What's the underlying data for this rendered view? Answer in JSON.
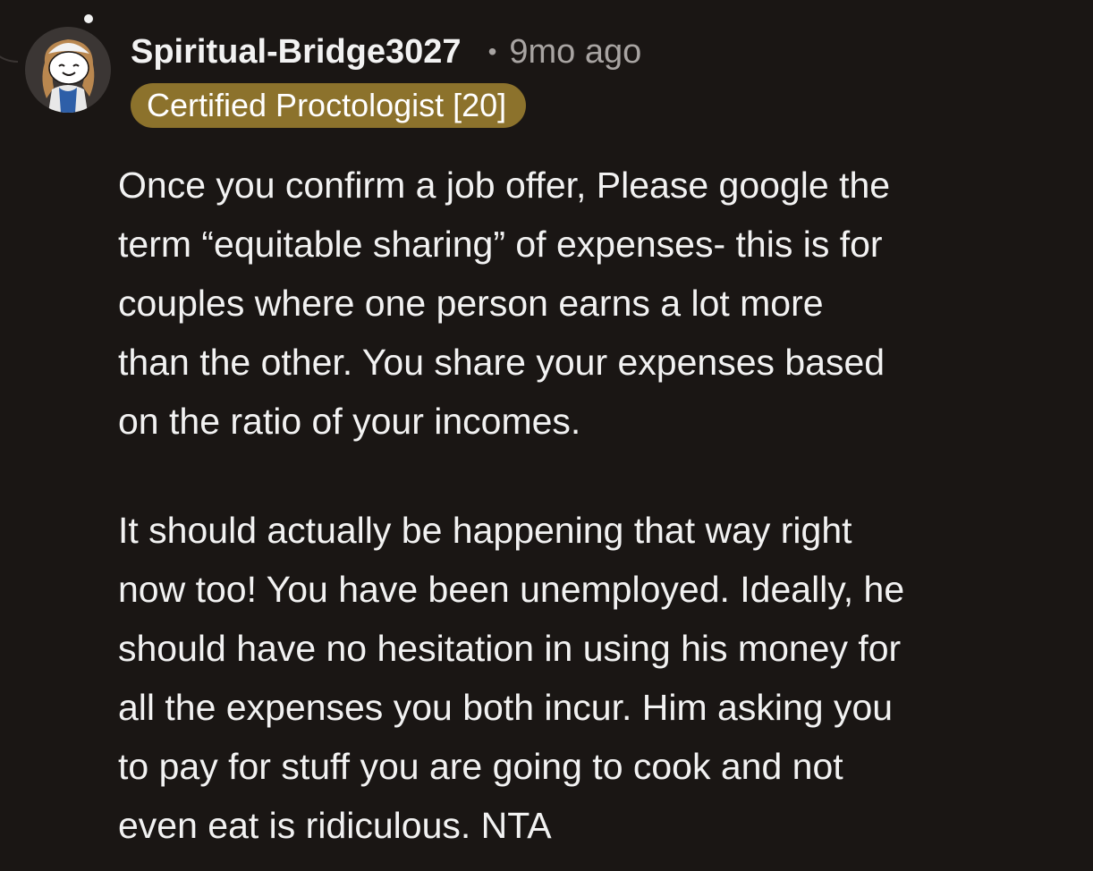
{
  "comment": {
    "author": "Spiritual-Bridge3027",
    "separator": "•",
    "timestamp": "9mo ago",
    "flair": "Certified Proctologist [20]",
    "paragraphs": [
      "Once you confirm a job offer, Please google the\nterm “equitable sharing” of expenses- this is for\ncouples where one person earns a lot more\nthan the other. You share your expenses based\non the ratio of your incomes.",
      "It should actually be happening that way right\nnow too! You have been unemployed. Ideally, he\nshould have no hesitation in using his money for\nall the expenses you both incur. Him asking you\nto pay for stuff you are going to cook and not\neven eat is ridiculous. NTA"
    ]
  },
  "colors": {
    "background": "#1a1614",
    "text": "#f2f2f2",
    "muted": "#a8a4a2",
    "flair_bg": "#8c722c"
  },
  "icons": {
    "avatar": "snoo-avatar-icon"
  }
}
